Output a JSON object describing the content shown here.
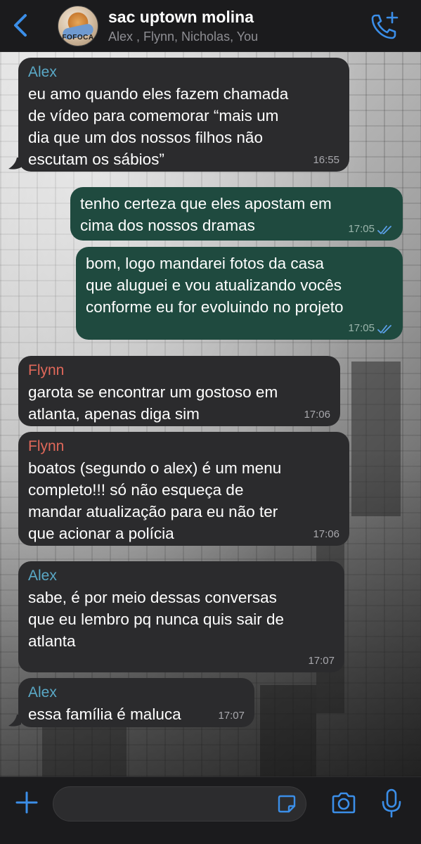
{
  "header": {
    "title": "sac uptown molina",
    "members": "Alex , Flynn, Nicholas, You",
    "avatar_text": "FOFOCA",
    "back_icon": "chevron-left-icon",
    "call_icon": "add-call-icon"
  },
  "colors": {
    "accent": "#3b8ee8",
    "incoming_bubble": "#2b2b2d",
    "outgoing_bubble": "#1f4a3f",
    "alex_name": "#5aa9c7",
    "flynn_name": "#e0685a"
  },
  "messages": [
    {
      "direction": "incoming",
      "sender": "Alex",
      "lines": [
        "eu amo quando eles fazem chamada",
        "de vídeo para comemorar “mais um",
        "dia que um dos nossos filhos não",
        "escutam os sábios”"
      ],
      "time": "16:55"
    },
    {
      "direction": "outgoing",
      "lines": [
        "tenho certeza que eles apostam em",
        "cima dos nossos dramas"
      ],
      "time": "17:05",
      "status": "read"
    },
    {
      "direction": "outgoing",
      "lines": [
        "bom, logo mandarei fotos da casa",
        "que aluguei e vou atualizando vocês",
        "conforme eu for evoluindo no projeto"
      ],
      "time": "17:05",
      "status": "read"
    },
    {
      "direction": "incoming",
      "sender": "Flynn",
      "lines": [
        "garota se encontrar um gostoso em",
        "atlanta, apenas diga sim"
      ],
      "time": "17:06"
    },
    {
      "direction": "incoming",
      "sender": "Flynn",
      "lines": [
        "boatos (segundo o alex) é um menu",
        "completo!!! só não esqueça de",
        "mandar atualização para eu não ter",
        "que acionar a polícia"
      ],
      "time": "17:06"
    },
    {
      "direction": "incoming",
      "sender": "Alex",
      "lines": [
        "sabe, é por meio dessas conversas",
        "que eu lembro pq nunca quis sair de",
        "atlanta"
      ],
      "time": "17:07"
    },
    {
      "direction": "incoming",
      "sender": "Alex",
      "lines": [
        "essa família é maluca"
      ],
      "time": "17:07"
    }
  ],
  "composer": {
    "value": "",
    "plus_icon": "plus-icon",
    "sticker_icon": "sticker-icon",
    "camera_icon": "camera-icon",
    "mic_icon": "microphone-icon"
  }
}
